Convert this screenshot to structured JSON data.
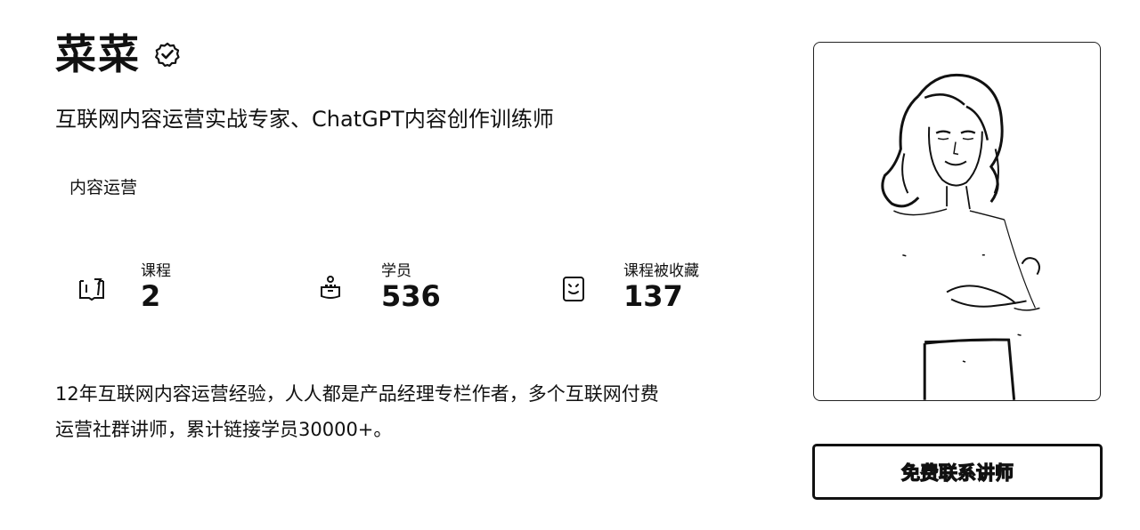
{
  "teacher": {
    "name": "菜菜",
    "verified_icon": "verified-badge-icon",
    "title": "互联网内容运营实战专家、ChatGPT内容创作训练师",
    "tag": "内容运营"
  },
  "stats": [
    {
      "icon": "book-icon",
      "label": "课程",
      "value": "2"
    },
    {
      "icon": "student-icon",
      "label": "学员",
      "value": "536"
    },
    {
      "icon": "favorite-icon",
      "label": "课程被收藏",
      "value": "137"
    }
  ],
  "bio": {
    "line1": "12年互联网内容运营经验，人人都是产品经理专栏作者，多个互联网付费",
    "line2": "运营社群讲师，累计链接学员30000+。"
  },
  "cta": {
    "label": "免费联系讲师"
  }
}
